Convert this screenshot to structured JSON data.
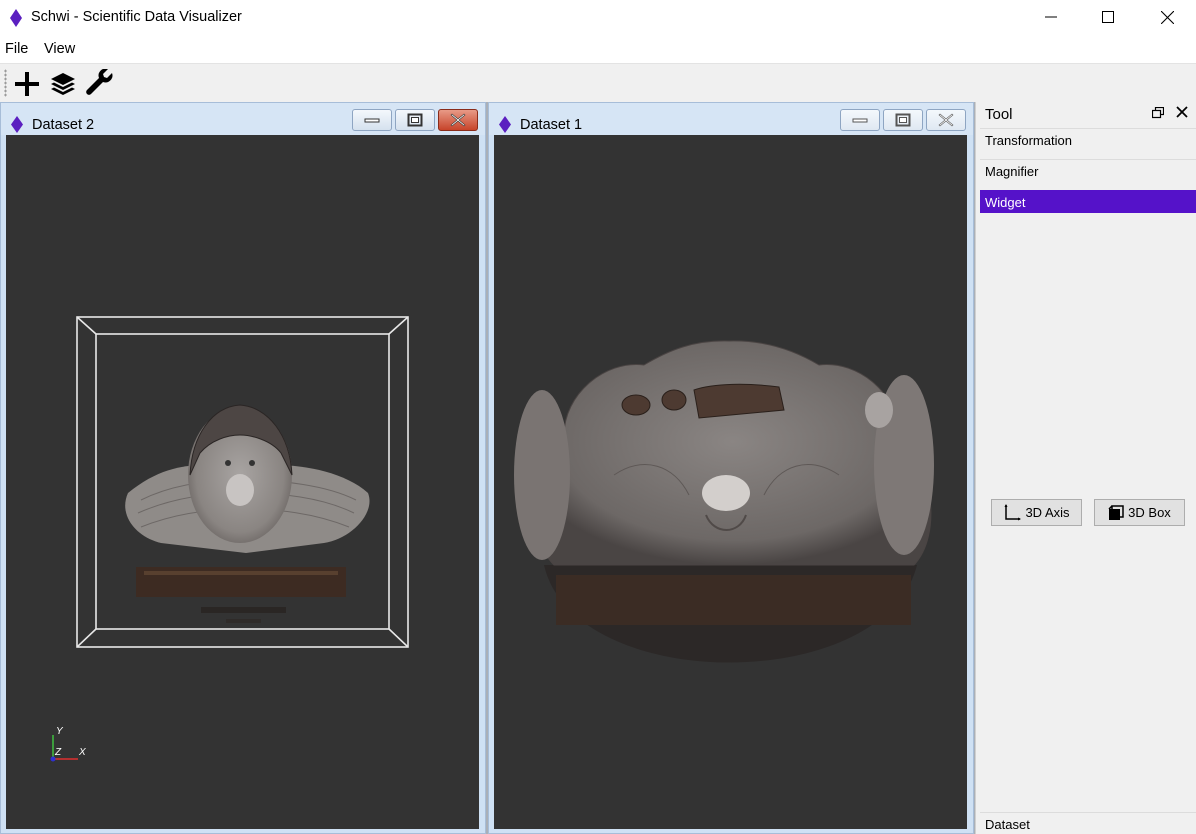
{
  "window": {
    "title": "Schwi - Scientific Data Visualizer",
    "app_icon": "purple-diamond-icon",
    "controls": [
      "minimize-icon",
      "maximize-icon",
      "close-icon"
    ]
  },
  "menu": {
    "items": [
      {
        "label": "File"
      },
      {
        "label": "View"
      }
    ]
  },
  "toolbar": {
    "buttons": [
      {
        "icon": "plus-icon"
      },
      {
        "icon": "layers-icon"
      },
      {
        "icon": "wrench-icon"
      }
    ]
  },
  "subwindows": [
    {
      "title": "Dataset 2",
      "icon": "purple-diamond-icon",
      "axes": {
        "y": "Y",
        "z": "Z",
        "x": "X"
      }
    },
    {
      "title": "Dataset 1",
      "icon": "purple-diamond-icon"
    }
  ],
  "tool_panel": {
    "title": "Tool",
    "items": [
      {
        "label": "Transformation",
        "selected": false
      },
      {
        "label": "Magnifier",
        "selected": false
      },
      {
        "label": "Widget",
        "selected": true
      }
    ],
    "widget_buttons": [
      {
        "label": "3D Axis",
        "icon": "axis-icon"
      },
      {
        "label": "3D Box",
        "icon": "box-icon"
      }
    ],
    "footer": "Dataset"
  },
  "colors": {
    "accent": "#5512c9",
    "viewport_bg": "#333333",
    "app_icon": "#5b1fc0"
  }
}
